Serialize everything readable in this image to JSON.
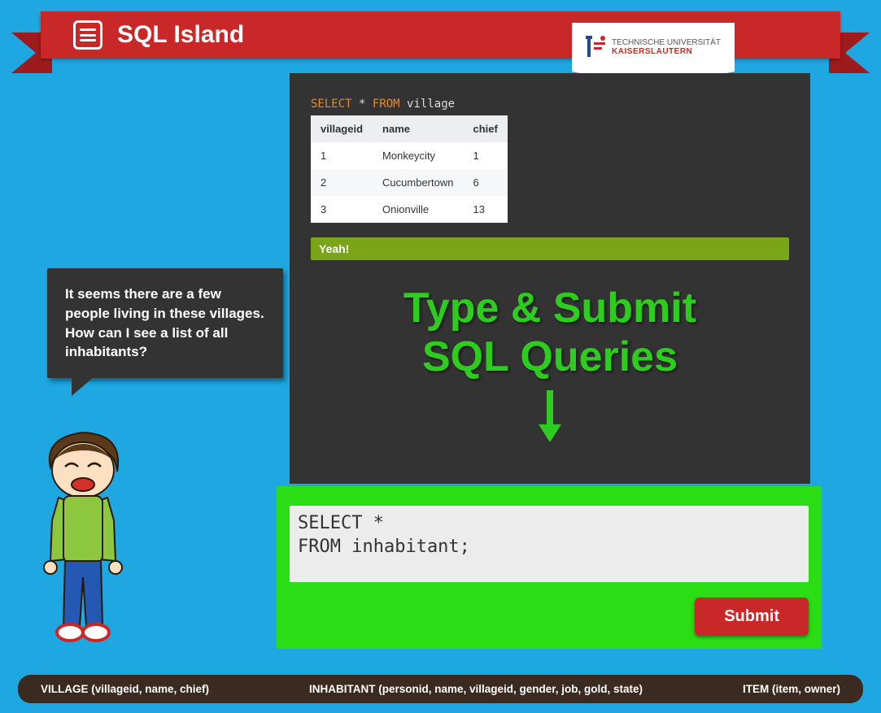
{
  "header": {
    "title": "SQL Island",
    "logo_line1": "TECHNISCHE UNIVERSITÄT",
    "logo_line2": "KAISERSLAUTERN"
  },
  "dialog": {
    "text": "It seems there are a few people living in these villages. How can I see a list of all inhabitants?"
  },
  "query_shown": {
    "select": "SELECT",
    "star": "*",
    "from": "FROM",
    "table": "village"
  },
  "result": {
    "columns": [
      "villageid",
      "name",
      "chief"
    ],
    "rows": [
      [
        "1",
        "Monkeycity",
        "1"
      ],
      [
        "2",
        "Cucumbertown",
        "6"
      ],
      [
        "3",
        "Onionville",
        "13"
      ]
    ]
  },
  "feedback": "Yeah!",
  "hint": {
    "line1": "Type & Submit",
    "line2": "SQL Queries"
  },
  "editor": {
    "value": "SELECT *\nFROM inhabitant;"
  },
  "submit_label": "Submit",
  "schema": {
    "village": "VILLAGE (villageid, name, chief)",
    "inhabitant": "INHABITANT (personid, name, villageid, gender, job, gold, state)",
    "item": "ITEM (item, owner)"
  }
}
